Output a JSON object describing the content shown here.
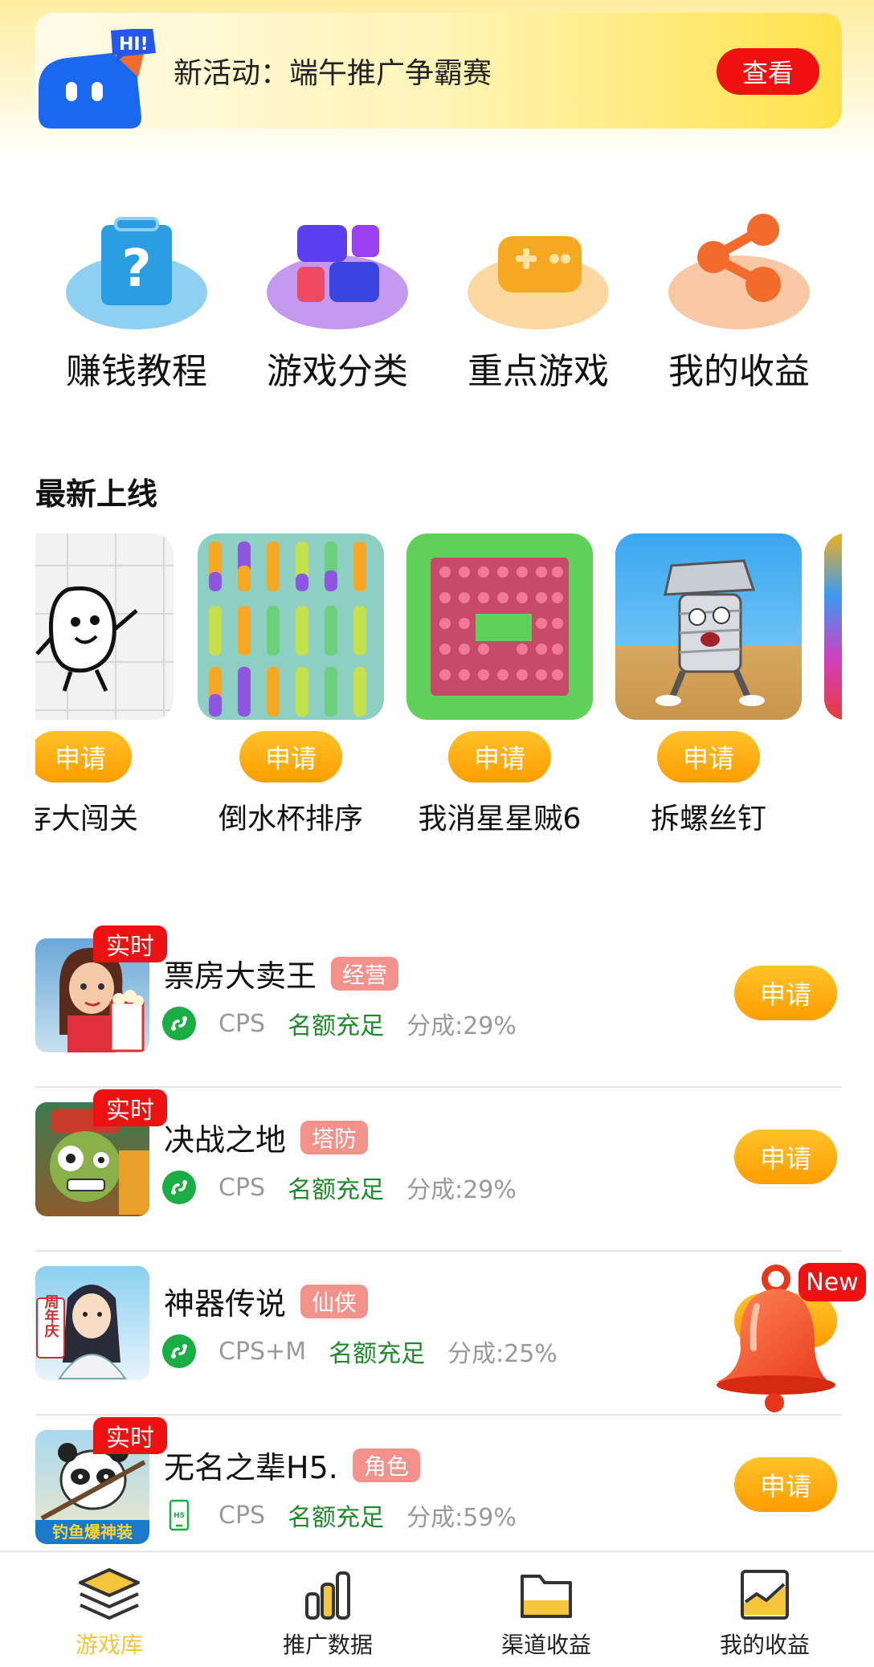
{
  "banner": {
    "title": "新活动：端午推广争霸赛",
    "button_label": "查看",
    "mascot_text": "HI!"
  },
  "quick_entries": [
    {
      "label": "赚钱教程",
      "icon": "question-box-icon",
      "color": "#2a9ee0"
    },
    {
      "label": "游戏分类",
      "icon": "category-grid-icon",
      "color": "#7a3be0"
    },
    {
      "label": "重点游戏",
      "icon": "gamepad-icon",
      "color": "#f7a823"
    },
    {
      "label": "我的收益",
      "icon": "share-icon",
      "color": "#f26b2d"
    }
  ],
  "newest": {
    "title": "最新上线",
    "apply_label": "申请",
    "games": [
      {
        "name": "存大闯关"
      },
      {
        "name": "倒水杯排序"
      },
      {
        "name": "我消星星贼6"
      },
      {
        "name": "拆螺丝钉"
      }
    ]
  },
  "game_list": [
    {
      "name": "票房大卖王",
      "tag": "经营",
      "badge": "实时",
      "platform": "CPS",
      "platform_icon": "mini-program-icon",
      "quota": "名额充足",
      "share": "分成:29%",
      "apply_label": "申请"
    },
    {
      "name": "决战之地",
      "tag": "塔防",
      "badge": "实时",
      "platform": "CPS",
      "platform_icon": "mini-program-icon",
      "quota": "名额充足",
      "share": "分成:29%",
      "apply_label": "申请"
    },
    {
      "name": "神器传说",
      "tag": "仙侠",
      "badge": "",
      "platform": "CPS+M",
      "platform_icon": "mini-program-icon",
      "quota": "名额充足",
      "share": "分成:25%",
      "apply_label": "申请",
      "icon_text": "周年庆"
    },
    {
      "name": "无名之辈H5.",
      "tag": "角色",
      "badge": "实时",
      "platform": "CPS",
      "platform_icon": "h5-icon",
      "quota": "名额充足",
      "share": "分成:59%",
      "apply_label": "申请",
      "icon_text": "钓鱼爆神装"
    }
  ],
  "notification": {
    "badge": "New"
  },
  "tabs": [
    {
      "label": "游戏库",
      "active": true,
      "icon": "layers-icon"
    },
    {
      "label": "推广数据",
      "active": false,
      "icon": "bar-chart-icon"
    },
    {
      "label": "渠道收益",
      "active": false,
      "icon": "folder-icon"
    },
    {
      "label": "我的收益",
      "active": false,
      "icon": "trend-image-icon"
    }
  ],
  "colors": {
    "accent": "#ff9d00",
    "alert": "#ee1111",
    "quota_green": "#1e8a2c",
    "active_tab": "#f4c43a"
  }
}
